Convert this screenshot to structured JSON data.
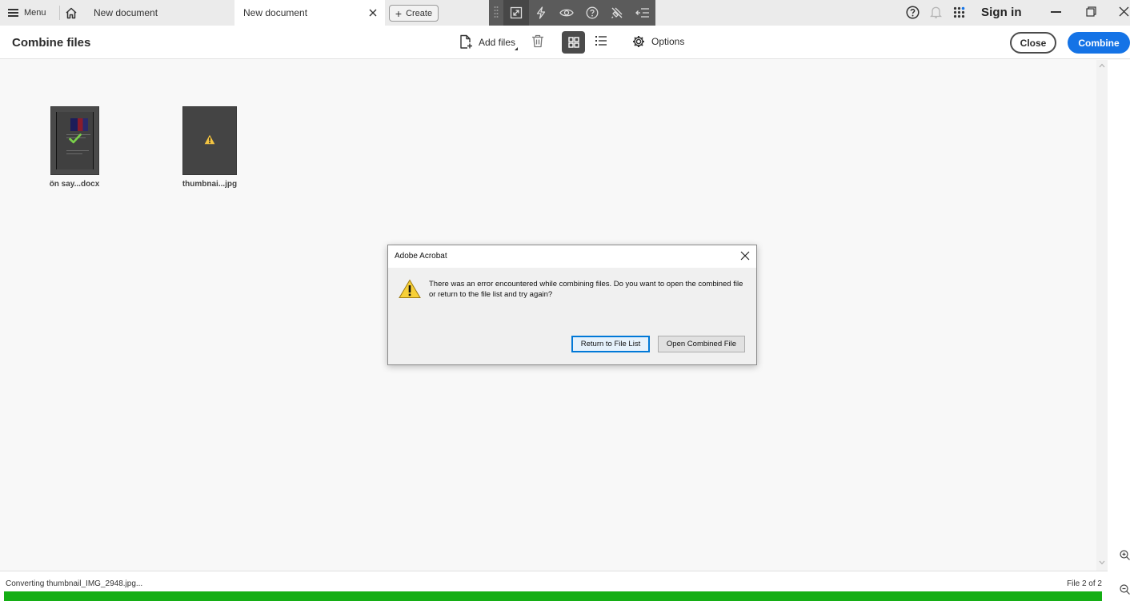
{
  "titlebar": {
    "menu_label": "Menu",
    "tabs": [
      {
        "label": "New document",
        "active": false
      },
      {
        "label": "New document",
        "active": true
      }
    ],
    "create_label": "Create",
    "sign_in_label": "Sign in",
    "floating_tools": [
      "grip-icon",
      "marquee-zoom-icon",
      "lightning-icon",
      "eye-icon",
      "help-circle-icon",
      "pin-off-icon",
      "collapse-panel-icon"
    ]
  },
  "toolbar": {
    "title": "Combine files",
    "add_files_label": "Add files",
    "options_label": "Options",
    "close_label": "Close",
    "combine_label": "Combine",
    "accent_color": "#1473e6"
  },
  "files": [
    {
      "name": "ön say...docx",
      "status": "converted"
    },
    {
      "name": "thumbnai...jpg",
      "status": "warning"
    }
  ],
  "dialog": {
    "title": "Adobe Acrobat",
    "message": "There was an error encountered while combining files. Do you want to open the combined file or return to the file list and try again?",
    "primary_button": "Return to File List",
    "secondary_button": "Open Combined File"
  },
  "status": {
    "text": "Converting thumbnail_IMG_2948.jpg...",
    "file_count": "File 2 of 2",
    "progress_fraction": 1.0,
    "progress_color": "#14ae14"
  }
}
